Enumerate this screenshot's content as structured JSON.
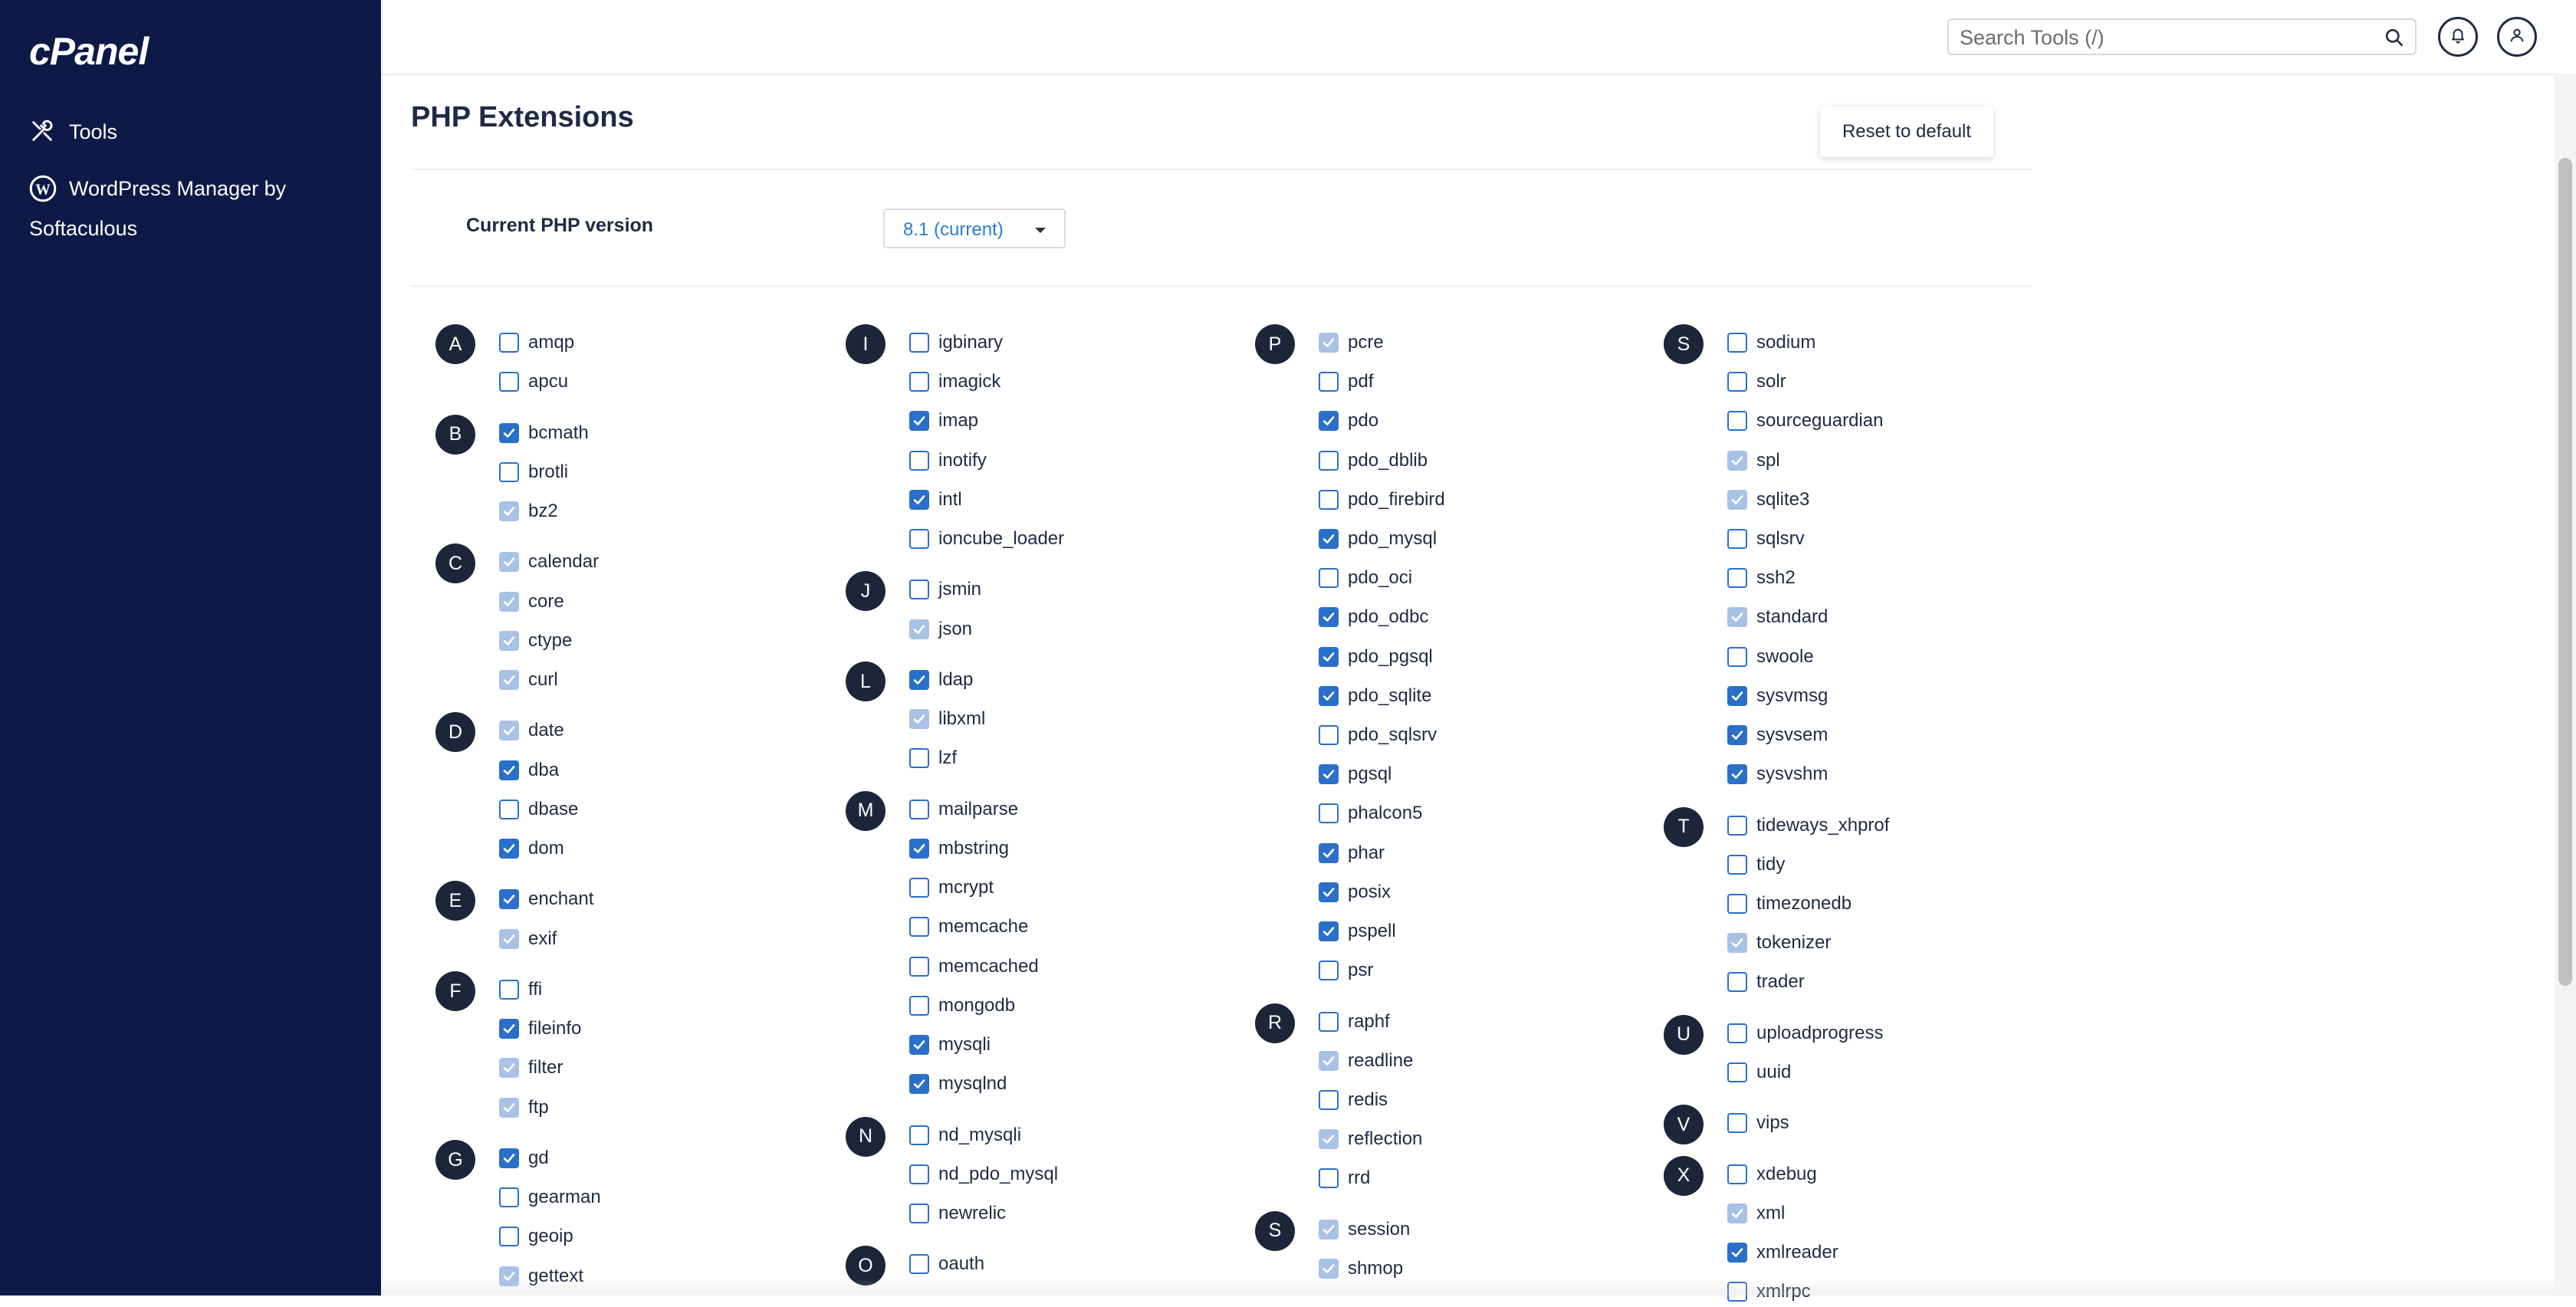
{
  "sidebar": {
    "logo": "cPanel",
    "items": [
      {
        "label": "Tools",
        "icon": "tools-icon"
      },
      {
        "label": "WordPress Manager by Softaculous",
        "icon": "wordpress-icon"
      }
    ]
  },
  "topbar": {
    "search_placeholder": "Search Tools (/)",
    "icons": [
      "search-icon",
      "bell-icon",
      "user-icon"
    ]
  },
  "main": {
    "title": "PHP Extensions",
    "reset_label": "Reset to default",
    "version_label": "Current PHP version",
    "version_value": "8.1 (current)"
  },
  "colors": {
    "sidebar": "#0d1a47",
    "accent": "#2a6fc9",
    "badge": "#1c2638"
  },
  "columns": [
    {
      "groups": [
        {
          "letter": "A",
          "items": [
            [
              "amqp",
              "off"
            ],
            [
              "apcu",
              "off"
            ]
          ]
        },
        {
          "letter": "B",
          "items": [
            [
              "bcmath",
              "on"
            ],
            [
              "brotli",
              "off"
            ],
            [
              "bz2",
              "on-dis"
            ]
          ]
        },
        {
          "letter": "C",
          "items": [
            [
              "calendar",
              "on-dis"
            ],
            [
              "core",
              "on-dis"
            ],
            [
              "ctype",
              "on-dis"
            ],
            [
              "curl",
              "on-dis"
            ]
          ]
        },
        {
          "letter": "D",
          "items": [
            [
              "date",
              "on-dis"
            ],
            [
              "dba",
              "on"
            ],
            [
              "dbase",
              "off"
            ],
            [
              "dom",
              "on"
            ]
          ]
        },
        {
          "letter": "E",
          "items": [
            [
              "enchant",
              "on"
            ],
            [
              "exif",
              "on-dis"
            ]
          ]
        },
        {
          "letter": "F",
          "items": [
            [
              "ffi",
              "off"
            ],
            [
              "fileinfo",
              "on"
            ],
            [
              "filter",
              "on-dis"
            ],
            [
              "ftp",
              "on-dis"
            ]
          ]
        },
        {
          "letter": "G",
          "items": [
            [
              "gd",
              "on"
            ],
            [
              "gearman",
              "off"
            ],
            [
              "geoip",
              "off"
            ],
            [
              "gettext",
              "on-dis"
            ]
          ]
        }
      ]
    },
    {
      "groups": [
        {
          "letter": "I",
          "items": [
            [
              "igbinary",
              "off"
            ],
            [
              "imagick",
              "off"
            ],
            [
              "imap",
              "on"
            ],
            [
              "inotify",
              "off"
            ],
            [
              "intl",
              "on"
            ],
            [
              "ioncube_loader",
              "off"
            ]
          ]
        },
        {
          "letter": "J",
          "items": [
            [
              "jsmin",
              "off"
            ],
            [
              "json",
              "on-dis"
            ]
          ]
        },
        {
          "letter": "L",
          "items": [
            [
              "ldap",
              "on"
            ],
            [
              "libxml",
              "on-dis"
            ],
            [
              "lzf",
              "off"
            ]
          ]
        },
        {
          "letter": "M",
          "items": [
            [
              "mailparse",
              "off"
            ],
            [
              "mbstring",
              "on"
            ],
            [
              "mcrypt",
              "off"
            ],
            [
              "memcache",
              "off"
            ],
            [
              "memcached",
              "off"
            ],
            [
              "mongodb",
              "off"
            ],
            [
              "mysqli",
              "on"
            ],
            [
              "mysqlnd",
              "on"
            ]
          ]
        },
        {
          "letter": "N",
          "items": [
            [
              "nd_mysqli",
              "off"
            ],
            [
              "nd_pdo_mysql",
              "off"
            ],
            [
              "newrelic",
              "off"
            ]
          ]
        },
        {
          "letter": "O",
          "items": [
            [
              "oauth",
              "off"
            ]
          ]
        }
      ]
    },
    {
      "groups": [
        {
          "letter": "P",
          "items": [
            [
              "pcre",
              "on-dis"
            ],
            [
              "pdf",
              "off"
            ],
            [
              "pdo",
              "on"
            ],
            [
              "pdo_dblib",
              "off"
            ],
            [
              "pdo_firebird",
              "off"
            ],
            [
              "pdo_mysql",
              "on"
            ],
            [
              "pdo_oci",
              "off"
            ],
            [
              "pdo_odbc",
              "on"
            ],
            [
              "pdo_pgsql",
              "on"
            ],
            [
              "pdo_sqlite",
              "on"
            ],
            [
              "pdo_sqlsrv",
              "off"
            ],
            [
              "pgsql",
              "on"
            ],
            [
              "phalcon5",
              "off"
            ],
            [
              "phar",
              "on"
            ],
            [
              "posix",
              "on"
            ],
            [
              "pspell",
              "on"
            ],
            [
              "psr",
              "off"
            ]
          ]
        },
        {
          "letter": "R",
          "items": [
            [
              "raphf",
              "off"
            ],
            [
              "readline",
              "on-dis"
            ],
            [
              "redis",
              "off"
            ],
            [
              "reflection",
              "on-dis"
            ],
            [
              "rrd",
              "off"
            ]
          ]
        },
        {
          "letter": "S",
          "items": [
            [
              "session",
              "on-dis"
            ],
            [
              "shmop",
              "on-dis"
            ]
          ]
        }
      ]
    },
    {
      "groups": [
        {
          "letter": "S",
          "items": [
            [
              "sodium",
              "off"
            ],
            [
              "solr",
              "off"
            ],
            [
              "sourceguardian",
              "off"
            ],
            [
              "spl",
              "on-dis"
            ],
            [
              "sqlite3",
              "on-dis"
            ],
            [
              "sqlsrv",
              "off"
            ],
            [
              "ssh2",
              "off"
            ],
            [
              "standard",
              "on-dis"
            ],
            [
              "swoole",
              "off"
            ],
            [
              "sysvmsg",
              "on"
            ],
            [
              "sysvsem",
              "on"
            ],
            [
              "sysvshm",
              "on"
            ]
          ]
        },
        {
          "letter": "T",
          "items": [
            [
              "tideways_xhprof",
              "off"
            ],
            [
              "tidy",
              "off"
            ],
            [
              "timezonedb",
              "off"
            ],
            [
              "tokenizer",
              "on-dis"
            ],
            [
              "trader",
              "off"
            ]
          ]
        },
        {
          "letter": "U",
          "items": [
            [
              "uploadprogress",
              "off"
            ],
            [
              "uuid",
              "off"
            ]
          ]
        },
        {
          "letter": "V",
          "items": [
            [
              "vips",
              "off"
            ]
          ]
        },
        {
          "letter": "X",
          "items": [
            [
              "xdebug",
              "off"
            ],
            [
              "xml",
              "on-dis"
            ],
            [
              "xmlreader",
              "on"
            ],
            [
              "xmlrpc",
              "off"
            ]
          ]
        }
      ]
    }
  ]
}
